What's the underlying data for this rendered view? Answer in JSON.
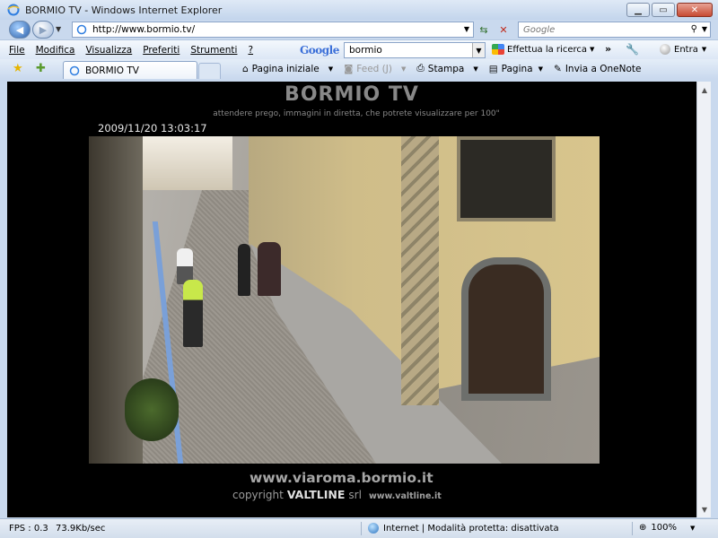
{
  "window": {
    "title": "BORMIO TV - Windows Internet Explorer"
  },
  "address": {
    "url": "http://www.bormio.tv/",
    "search_placeholder": "Google"
  },
  "menu": {
    "items": [
      "File",
      "Modifica",
      "Visualizza",
      "Preferiti",
      "Strumenti",
      "?"
    ]
  },
  "google_toolbar": {
    "logo": "Google",
    "query": "bormio",
    "search_button": "Effettua la ricerca",
    "more": "»",
    "signin": "Entra"
  },
  "tabs": {
    "active_tab": "BORMIO TV"
  },
  "commands": {
    "home": "Pagina iniziale",
    "feed": "Feed (J)",
    "print": "Stampa",
    "page": "Pagina",
    "onenote": "Invia a OneNote"
  },
  "page": {
    "brand": "BORMIO TV",
    "subtitle": "attendere prego, immagini in diretta, che potrete visualizzare per 100\"",
    "timestamp": "2009/11/20 13:03:17",
    "site_url": "www.viaroma.bormio.it",
    "copyright_prefix": "copyright",
    "company": "VALTLINE",
    "company_suffix": "srl",
    "company_url": "www.valtline.it"
  },
  "status": {
    "fps": "FPS : 0.3",
    "rate": "73.9Kb/sec",
    "zone": "Internet | Modalità protetta: disattivata",
    "zoom": "100%"
  },
  "colors": {
    "accent": "#2a5fa8",
    "page_background": "#000000"
  }
}
